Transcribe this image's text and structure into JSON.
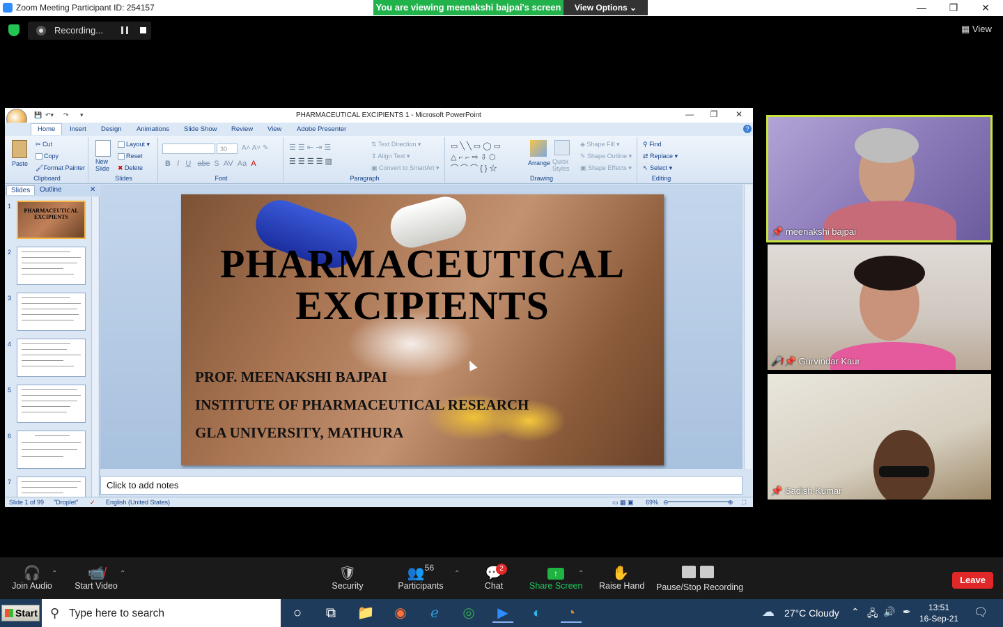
{
  "window": {
    "title": "Zoom Meeting Participant ID: 254157",
    "banner": "You are viewing meenakshi bajpai's screen",
    "view_options": "View Options ⌄",
    "minimize": "—",
    "maximize": "❐",
    "close": "✕"
  },
  "recording": {
    "label": "Recording...",
    "view_label": "View"
  },
  "ppt": {
    "title": "PHARMACEUTICAL EXCIPIENTS 1 - Microsoft PowerPoint",
    "tabs": [
      "Home",
      "Insert",
      "Design",
      "Animations",
      "Slide Show",
      "Review",
      "View",
      "Adobe Presenter"
    ],
    "clipboard": {
      "paste": "Paste",
      "cut": "Cut",
      "copy": "Copy",
      "format_painter": "Format Painter",
      "label": "Clipboard"
    },
    "slides_group": {
      "new_slide": "New Slide",
      "layout": "Layout",
      "reset": "Reset",
      "delete": "Delete",
      "label": "Slides"
    },
    "font_group": {
      "size": "30",
      "label": "Font"
    },
    "paragraph_group": {
      "text_direction": "Text Direction",
      "align_text": "Align Text",
      "convert": "Convert to SmartArt",
      "label": "Paragraph"
    },
    "drawing_group": {
      "arrange": "Arrange",
      "quick_styles": "Quick Styles",
      "shape_fill": "Shape Fill",
      "shape_outline": "Shape Outline",
      "shape_effects": "Shape Effects",
      "label": "Drawing"
    },
    "editing_group": {
      "find": "Find",
      "replace": "Replace",
      "select": "Select",
      "label": "Editing"
    },
    "pane_tabs": [
      "Slides",
      "Outline"
    ],
    "thumbnail_numbers": [
      "1",
      "2",
      "3",
      "4",
      "5",
      "6",
      "7"
    ],
    "thumb1_title": "PHARMACEUTICAL EXCIPIENTS",
    "slide": {
      "title_line1": "PHARMACEUTICAL",
      "title_line2": "EXCIPIENTS",
      "author": "PROF. MEENAKSHI BAJPAI",
      "institute": "INSTITUTE OF PHARMACEUTICAL RESEARCH",
      "university": "GLA UNIVERSITY,  MATHURA"
    },
    "notes_placeholder": "Click to add notes",
    "status": {
      "slide": "Slide 1 of 99",
      "theme": "\"Droplet\"",
      "language": "English (United States)",
      "zoom": "69%"
    }
  },
  "participants": [
    {
      "name": "meenakshi bajpai",
      "muted": false,
      "active": true
    },
    {
      "name": "Gurvindar Kaur",
      "muted": true,
      "active": false
    },
    {
      "name": "Sadish Kumar",
      "muted": false,
      "active": false
    }
  ],
  "toolbar": {
    "join_audio": "Join Audio",
    "start_video": "Start Video",
    "security": "Security",
    "participants": "Participants",
    "participants_count": "56",
    "chat": "Chat",
    "chat_badge": "2",
    "share_screen": "Share Screen",
    "raise_hand": "Raise Hand",
    "recording": "Pause/Stop Recording",
    "leave": "Leave"
  },
  "taskbar": {
    "start": "Start",
    "search_placeholder": "Type here to search",
    "weather": "27°C  Cloudy",
    "time": "13:51",
    "date": "16-Sep-21"
  },
  "colors": {
    "zoom_green": "#22b24c",
    "active_speaker": "#c9e33c",
    "leave_red": "#e02828"
  }
}
